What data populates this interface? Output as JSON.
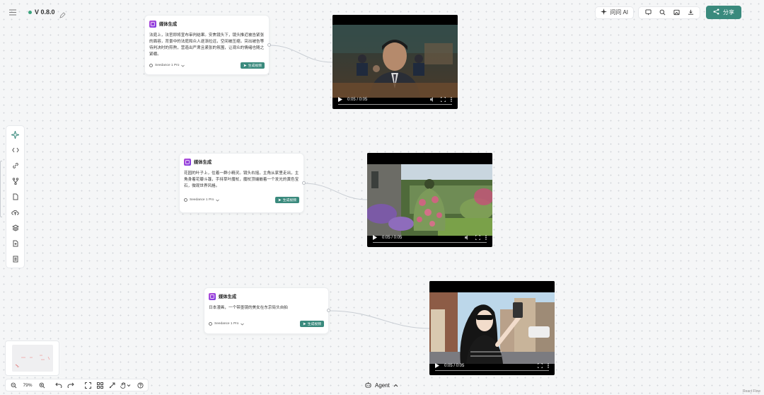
{
  "header": {
    "version": "V 0.8.0",
    "ask_ai_label": "问问 AI",
    "share_label": "分享"
  },
  "nodes": [
    {
      "title": "媒体生成",
      "text": "法庭上，法官即将宣布审判结果。安焦镜头下，镜头推近被告紧张的面容，背景中的法庭和众人逐渐拉远，空间被压缩，突出被告等待判决时的煎熬，营造出严肃且紧张的氛围，让观众的情绪也随之紧绷。",
      "model": "Seedance 1 Pro",
      "button": "生成视频",
      "video_time": "0:05 / 0:05"
    },
    {
      "title": "媒体生成",
      "text": "花园的叶子上，住着一群小精灵。镜头右摇，主角从家里走出，主角身着花瓣斗篷，手持草叶魔杖，魔杖顶端嵌着一个发光的黄色宝石，微观世界风格。",
      "model": "Seedance 1 Pro",
      "button": "生成视频",
      "video_time": "0:05 / 0:05"
    },
    {
      "title": "媒体生成",
      "text": "日本漫画，一个带墨镜的美女在东京街头自拍",
      "model": "Seedance 1 Pro",
      "button": "生成视频",
      "video_time": "0:05 / 0:05"
    }
  ],
  "bottom": {
    "zoom": "79%",
    "agent_label": "Agent",
    "watermark": "React Flow"
  },
  "colors": {
    "accent": "#3a8a7d",
    "badge": "#9b45db"
  }
}
